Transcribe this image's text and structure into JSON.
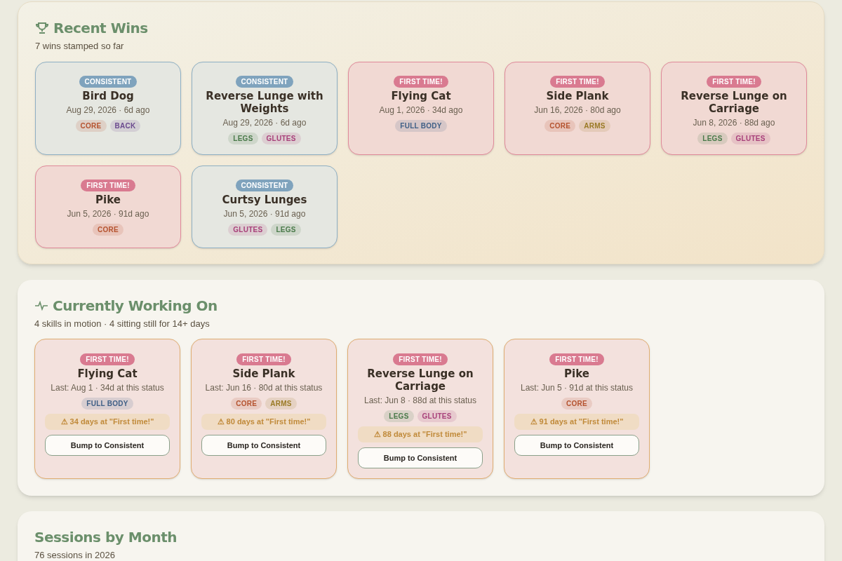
{
  "recent_wins": {
    "title": "Recent Wins",
    "subtitle": "7 wins stamped so far",
    "cards": [
      {
        "status": {
          "kind": "consistent",
          "label": "CONSISTENT"
        },
        "name": "Bird Dog",
        "date": "Aug 29, 2026 · 6d ago",
        "tags": [
          {
            "label": "CORE",
            "color": "#b5532f"
          },
          {
            "label": "BACK",
            "color": "#6b4a8f"
          }
        ]
      },
      {
        "status": {
          "kind": "consistent",
          "label": "CONSISTENT"
        },
        "name": "Reverse Lunge with Weights",
        "date": "Aug 29, 2026 · 6d ago",
        "tags": [
          {
            "label": "LEGS",
            "color": "#4a7a4a"
          },
          {
            "label": "GLUTES",
            "color": "#a8407a"
          }
        ]
      },
      {
        "status": {
          "kind": "first_time",
          "label": "FIRST TIME!"
        },
        "name": "Flying Cat",
        "date": "Aug 1, 2026 · 34d ago",
        "tags": [
          {
            "label": "FULL BODY",
            "color": "#3f5f86"
          }
        ]
      },
      {
        "status": {
          "kind": "first_time",
          "label": "FIRST TIME!"
        },
        "name": "Side Plank",
        "date": "Jun 16, 2026 · 80d ago",
        "tags": [
          {
            "label": "CORE",
            "color": "#b5532f"
          },
          {
            "label": "ARMS",
            "color": "#9a7a25"
          }
        ]
      },
      {
        "status": {
          "kind": "first_time",
          "label": "FIRST TIME!"
        },
        "name": "Reverse Lunge on Carriage",
        "date": "Jun 8, 2026 · 88d ago",
        "tags": [
          {
            "label": "LEGS",
            "color": "#4a7a4a"
          },
          {
            "label": "GLUTES",
            "color": "#a8407a"
          }
        ]
      },
      {
        "status": {
          "kind": "first_time",
          "label": "FIRST TIME!"
        },
        "name": "Pike",
        "date": "Jun 5, 2026 · 91d ago",
        "tags": [
          {
            "label": "CORE",
            "color": "#b5532f"
          }
        ]
      },
      {
        "status": {
          "kind": "consistent",
          "label": "CONSISTENT"
        },
        "name": "Curtsy Lunges",
        "date": "Jun 5, 2026 · 91d ago",
        "tags": [
          {
            "label": "GLUTES",
            "color": "#a8407a"
          },
          {
            "label": "LEGS",
            "color": "#4a7a4a"
          }
        ]
      }
    ]
  },
  "working_on": {
    "title": "Currently Working On",
    "subtitle": "4 skills in motion · 4 sitting still for 14+ days",
    "cards": [
      {
        "status": {
          "kind": "first_time",
          "label": "FIRST TIME!"
        },
        "name": "Flying Cat",
        "date": "Last: Aug 1 · 34d at this status",
        "tags": [
          {
            "label": "FULL BODY",
            "color": "#3f5f86"
          }
        ],
        "warning": "⚠ 34 days at \"First time!\"",
        "button": "Bump to Consistent"
      },
      {
        "status": {
          "kind": "first_time",
          "label": "FIRST TIME!"
        },
        "name": "Side Plank",
        "date": "Last: Jun 16 · 80d at this status",
        "tags": [
          {
            "label": "CORE",
            "color": "#b5532f"
          },
          {
            "label": "ARMS",
            "color": "#9a7a25"
          }
        ],
        "warning": "⚠ 80 days at \"First time!\"",
        "button": "Bump to Consistent"
      },
      {
        "status": {
          "kind": "first_time",
          "label": "FIRST TIME!"
        },
        "name": "Reverse Lunge on Carriage",
        "date": "Last: Jun 8 · 88d at this status",
        "tags": [
          {
            "label": "LEGS",
            "color": "#4a7a4a"
          },
          {
            "label": "GLUTES",
            "color": "#a8407a"
          }
        ],
        "warning": "⚠ 88 days at \"First time!\"",
        "button": "Bump to Consistent"
      },
      {
        "status": {
          "kind": "first_time",
          "label": "FIRST TIME!"
        },
        "name": "Pike",
        "date": "Last: Jun 5 · 91d at this status",
        "tags": [
          {
            "label": "CORE",
            "color": "#b5532f"
          }
        ],
        "warning": "⚠ 91 days at \"First time!\"",
        "button": "Bump to Consistent"
      }
    ]
  },
  "sessions_by_month": {
    "title": "Sessions by Month",
    "subtitle": "76 sessions in 2026"
  }
}
